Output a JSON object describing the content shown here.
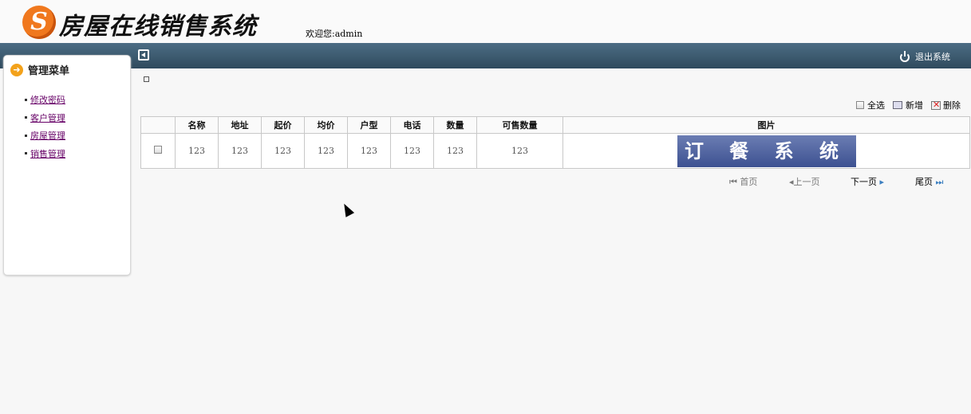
{
  "header": {
    "logo_letter": "S",
    "title": "房屋在线销售系统",
    "welcome": "欢迎您:admin"
  },
  "topbar": {
    "logout_label": "退出系统"
  },
  "sidebar": {
    "heading": "管理菜单",
    "items": [
      {
        "label": "修改密码"
      },
      {
        "label": "客户管理"
      },
      {
        "label": "房屋管理"
      },
      {
        "label": "销售管理"
      }
    ]
  },
  "toolbar": {
    "select_all": "全选",
    "add": "新增",
    "delete": "删除"
  },
  "table": {
    "columns": [
      "名称",
      "地址",
      "起价",
      "均价",
      "户型",
      "电话",
      "数量",
      "可售数量",
      "图片"
    ],
    "rows": [
      {
        "name": "123",
        "address": "123",
        "start_price": "123",
        "avg_price": "123",
        "layout": "123",
        "phone": "123",
        "quantity": "123",
        "available": "123",
        "image_text": "订 餐 系 统"
      }
    ]
  },
  "pager": {
    "first": "首页",
    "prev": "上一页",
    "next": "下一页",
    "last": "尾页"
  },
  "colors": {
    "topbar": "#3d5a6e",
    "logo": "#f0781e",
    "link": "#660066"
  }
}
